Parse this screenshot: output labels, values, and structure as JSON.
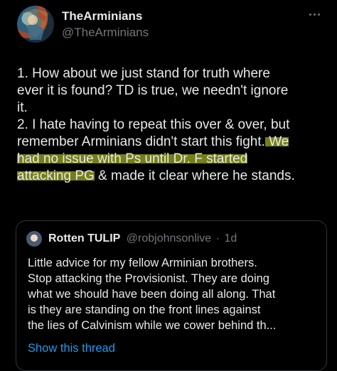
{
  "author": {
    "display_name": "TheArminians",
    "handle": "@TheArminians"
  },
  "tweet": {
    "line1": "1. How about we just stand for truth where",
    "line2": "ever it is found? TD is true, we needn't ignore",
    "line3": "it.",
    "line4": "2. I hate having to repeat this over & over, but",
    "line5_a": "remember Arminians didn't start this fight.",
    "line5_hl": " We",
    "line6_hl": "had no issue with Ps until Dr. F started",
    "line7_hl": "attacking PG",
    "line7_b": " & made it clear where he stands."
  },
  "quoted": {
    "display_name": "Rotten TULIP",
    "handle": "@robjohnsonlive",
    "separator": "·",
    "time": "1d",
    "line1": "Little advice for my fellow Arminian brothers.",
    "line2": "Stop attacking the Provisionist. They are doing",
    "line3": "what we should have been doing all along. That",
    "line4": "is they are standing on the front lines against",
    "line5": "the lies of Calvinism while we cower behind th...",
    "show_thread": "Show this thread"
  },
  "colors": {
    "background": "#000000",
    "text": "#e7e9ea",
    "secondary": "#71767b",
    "link": "#1d9bf0",
    "highlight": "#d6e62a"
  },
  "icons": {
    "avatar": "stained-glass-avatar",
    "more": "more-options-icon"
  }
}
